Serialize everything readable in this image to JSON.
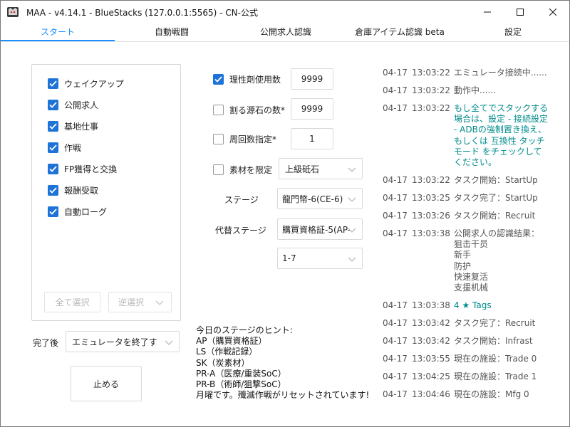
{
  "window": {
    "title": "MAA - v4.14.1 - BlueStacks (127.0.0.1:5565) - CN-公式",
    "icon": "maa-logo-icon"
  },
  "tabs": [
    {
      "label": "スタート",
      "active": true
    },
    {
      "label": "自動戦闘",
      "active": false
    },
    {
      "label": "公開求人認識",
      "active": false
    },
    {
      "label": "倉庫アイテム認識 beta",
      "active": false
    },
    {
      "label": "設定",
      "active": false
    }
  ],
  "accent_color": "#1890ff",
  "task_list": {
    "items": [
      {
        "label": "ウェイクアップ",
        "checked": true
      },
      {
        "label": "公開求人",
        "checked": true
      },
      {
        "label": "基地仕事",
        "checked": true
      },
      {
        "label": "作戦",
        "checked": true
      },
      {
        "label": "FP獲得と交換",
        "checked": true
      },
      {
        "label": "報酬受取",
        "checked": true
      },
      {
        "label": "自動ローグ",
        "checked": true
      }
    ],
    "select_all": "全て選択",
    "invert_select": "逆選択"
  },
  "after_finish": {
    "label": "完了後",
    "value": "エミュレータを終了す"
  },
  "stop_button": "止める",
  "fight_options": {
    "sanity": {
      "label": "理性剤使用数",
      "checked": true,
      "value": "9999"
    },
    "originium": {
      "label": "割る源石の数*",
      "checked": false,
      "value": "9999"
    },
    "times": {
      "label": "周回数指定*",
      "checked": false,
      "value": "1"
    },
    "material": {
      "label": "素材を限定",
      "checked": false,
      "value": "上級砥石"
    },
    "stage": {
      "label": "ステージ",
      "value": "龍門幣-6(CE-6)"
    },
    "alt_stage": {
      "label": "代替ステージ",
      "value": "購買資格証-5(AP-",
      "value2": "1-7"
    }
  },
  "hints": {
    "title": "今日のステージのヒント:",
    "lines": [
      "AP（購買資格証）",
      "LS（作戦記録）",
      "SK（炭素材）",
      "PR-A（医療/重装SoC）",
      "PR-B（術師/狙撃SoC）",
      "月曜です。殲滅作戦がリセットされています!"
    ]
  },
  "log": [
    {
      "date": "04-17",
      "time": "13:03:22",
      "msg": "エミュレータ接続中......",
      "teal": false
    },
    {
      "date": "04-17",
      "time": "13:03:22",
      "msg": "動作中......",
      "teal": false
    },
    {
      "date": "04-17",
      "time": "13:03:22",
      "msg": "もし全てでスタックする\n場合は、設定 - 接続設定\n- ADBの強制置き換え、\nもしくは 互換性 タッチ\nモード をチェックして\nください。",
      "teal": true
    },
    {
      "date": "04-17",
      "time": "13:03:22",
      "msg": "タスク開始：StartUp",
      "teal": false
    },
    {
      "date": "04-17",
      "time": "13:03:25",
      "msg": "タスク完了：StartUp",
      "teal": false
    },
    {
      "date": "04-17",
      "time": "13:03:26",
      "msg": "タスク開始：Recruit",
      "teal": false
    },
    {
      "date": "04-17",
      "time": "13:03:38",
      "msg": "公開求人の認識結果：\n狙击干员\n新手\n防护\n快速复活\n支援机械",
      "teal": false
    },
    {
      "date": "04-17",
      "time": "13:03:38",
      "msg": "4 ★ Tags",
      "teal": true
    },
    {
      "date": "04-17",
      "time": "13:03:42",
      "msg": "タスク完了：Recruit",
      "teal": false
    },
    {
      "date": "04-17",
      "time": "13:03:42",
      "msg": "タスク開始：Infrast",
      "teal": false
    },
    {
      "date": "04-17",
      "time": "13:03:55",
      "msg": "現在の施設：Trade 0",
      "teal": false
    },
    {
      "date": "04-17",
      "time": "13:04:25",
      "msg": "現在の施設：Trade 1",
      "teal": false
    },
    {
      "date": "04-17",
      "time": "13:04:46",
      "msg": "現在の施設：Mfg 0",
      "teal": false
    }
  ]
}
